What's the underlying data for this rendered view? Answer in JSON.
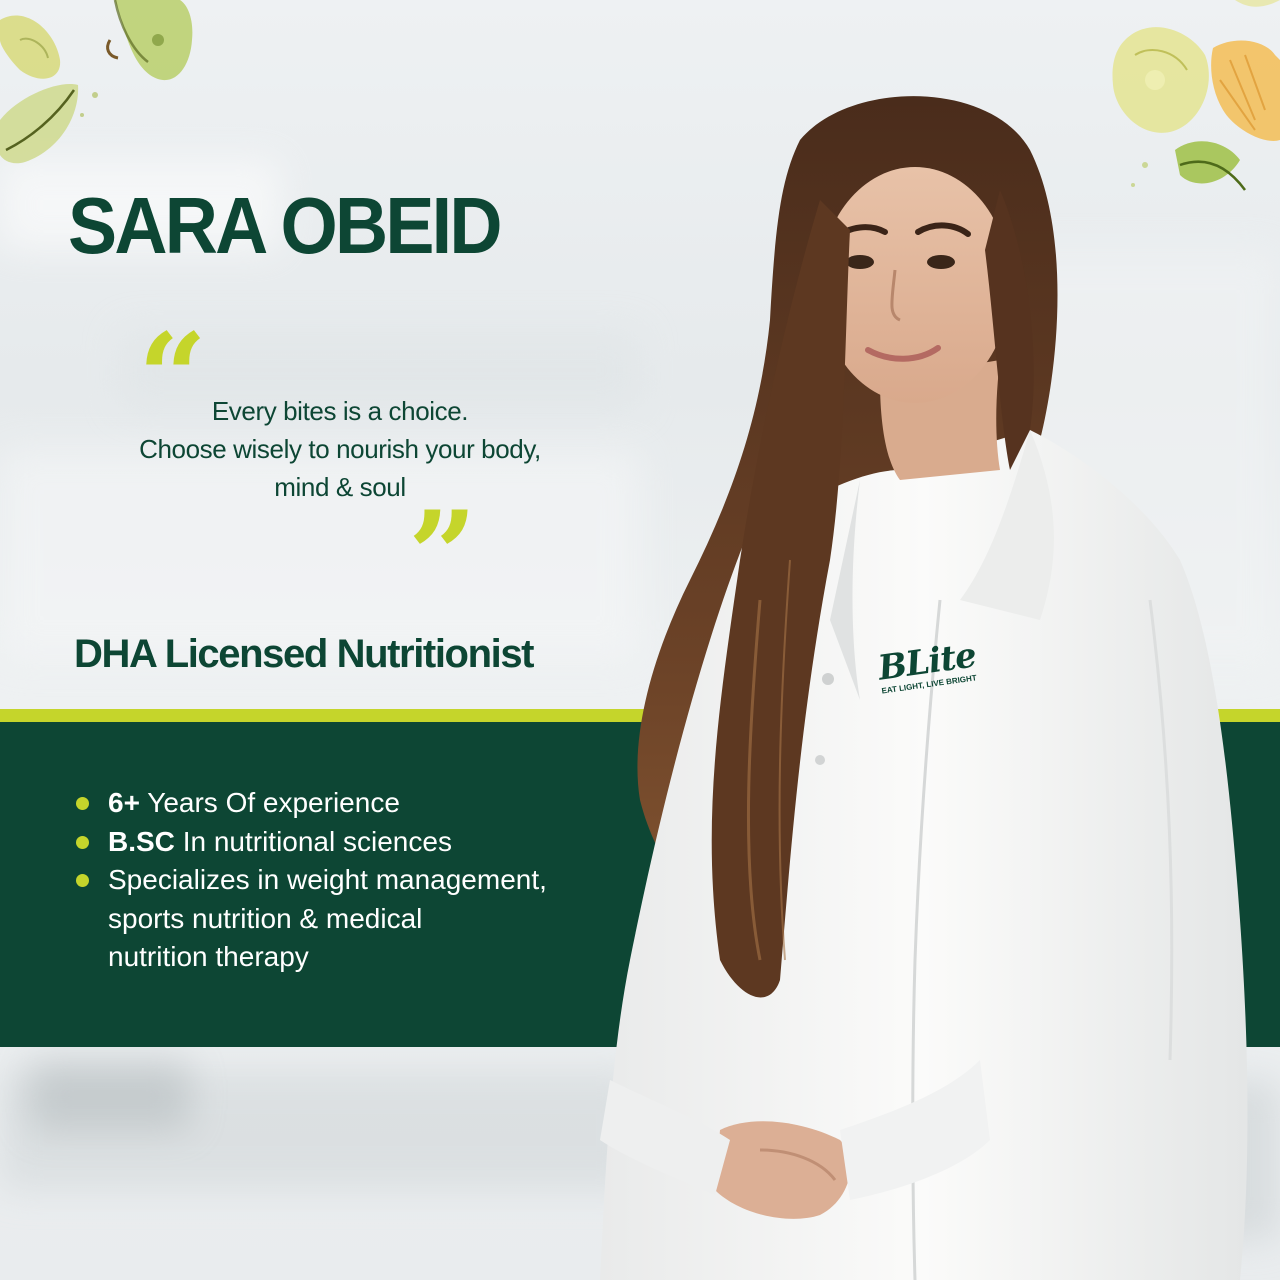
{
  "profile": {
    "name": "SARA OBEID",
    "quote_lines": [
      "Every bites is a choice.",
      "Choose wisely to nourish your body,",
      "mind & soul"
    ],
    "open_quote_mark": "“",
    "close_quote_mark": "”",
    "role": "DHA Licensed Nutritionist"
  },
  "facts": [
    {
      "bold": "6+",
      "lines": [
        "Years Of experience"
      ]
    },
    {
      "bold": "B.SC",
      "lines": [
        "In nutritional sciences"
      ]
    },
    {
      "bold": "",
      "lines": [
        "Specializes in weight management,",
        "sports nutrition & medical",
        "nutrition therapy"
      ]
    }
  ],
  "badge": {
    "brand": "BLite",
    "tagline": "EAT LIGHT, LIVE BRIGHT"
  },
  "colors": {
    "brand_green": "#0d4634",
    "accent_lime": "#c5d52b",
    "background": "#eceff1",
    "coat_white": "#f7f7f6",
    "hair_brown": "#5b3722"
  },
  "decor": {
    "top_left": "watercolor-pear-slices",
    "top_right": "watercolor-lemon-slices"
  }
}
